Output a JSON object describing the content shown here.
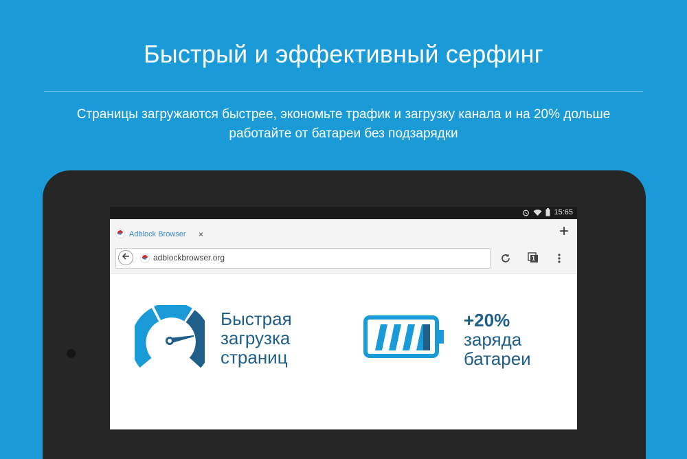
{
  "promo": {
    "headline": "Быстрый и эффективный серфинг",
    "subtitle_line1": "Страницы загружаются быстрее, экономьте трафик и загрузку канала и на 20% дольше",
    "subtitle_line2": "работайте от батареи без подзарядки"
  },
  "status_bar": {
    "time": "15:65"
  },
  "browser": {
    "tab_title": "Adblock Browser",
    "tab_close": "×",
    "new_tab": "+",
    "url": "adblockbrowser.org",
    "tabs_count": "1"
  },
  "features": {
    "speed": {
      "line1": "Быстрая",
      "line2": "загрузка",
      "line3": "страниц"
    },
    "battery": {
      "line1": "+20%",
      "line2": "заряда",
      "line3": "батареи"
    }
  },
  "colors": {
    "background": "#1a9bd7",
    "feature_dark": "#1f5f8a",
    "feature_light": "#1a9bd7",
    "tablet_frame": "#262626"
  },
  "icons": [
    "adblock-favicon",
    "back-arrow-icon",
    "reload-icon",
    "tabs-icon",
    "overflow-menu-icon",
    "alarm-icon",
    "wifi-icon",
    "battery-icon",
    "speedometer-icon",
    "battery-large-icon"
  ]
}
